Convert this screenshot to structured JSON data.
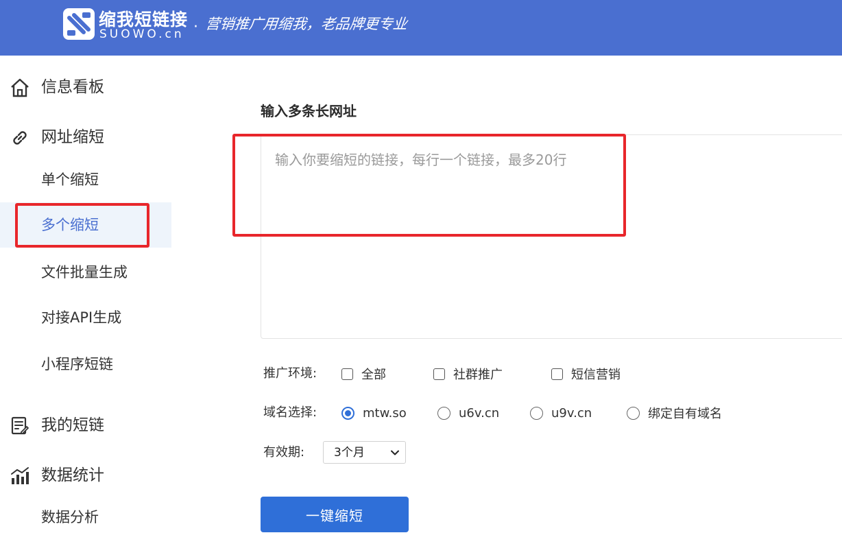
{
  "header": {
    "brand_name": "缩我短链接",
    "brand_domain": "SUOWO.cn",
    "separator": "·",
    "slogan": "营销推广用缩我，老品牌更专业",
    "background_color": "#4a6fd0"
  },
  "sidebar": {
    "sections": [
      {
        "label": "信息看板",
        "icon": "home-icon"
      },
      {
        "label": "网址缩短",
        "icon": "link-icon"
      },
      {
        "label": "我的短链",
        "icon": "edit-document-icon"
      },
      {
        "label": "数据统计",
        "icon": "bar-chart-icon"
      }
    ],
    "url_shorten_items": [
      {
        "label": "单个缩短",
        "active": false
      },
      {
        "label": "多个缩短",
        "active": true
      },
      {
        "label": "文件批量生成",
        "active": false
      },
      {
        "label": "对接API生成",
        "active": false
      },
      {
        "label": "小程序短链",
        "active": false
      }
    ],
    "stats_items": [
      {
        "label": "数据分析",
        "active": false
      }
    ],
    "active_color": "#4a6fd0",
    "active_background": "#eef4fb"
  },
  "main": {
    "section_title": "输入多条长网址",
    "textarea": {
      "value": "",
      "placeholder": "输入你要缩短的链接，每行一个链接，最多20行"
    },
    "promo_env": {
      "label": "推广环境:",
      "options": [
        {
          "label": "全部",
          "checked": false
        },
        {
          "label": "社群推广",
          "checked": false
        },
        {
          "label": "短信营销",
          "checked": false
        }
      ]
    },
    "domain_select": {
      "label": "域名选择:",
      "options": [
        {
          "label": "mtw.so",
          "selected": true
        },
        {
          "label": "u6v.cn",
          "selected": false
        },
        {
          "label": "u9v.cn",
          "selected": false
        },
        {
          "label": "绑定自有域名",
          "selected": false
        }
      ]
    },
    "validity": {
      "label": "有效期:",
      "selected": "3个月"
    },
    "submit_label": "一键缩短",
    "accent_color": "#2f6fd8",
    "annotation_color": "#e8262b"
  }
}
